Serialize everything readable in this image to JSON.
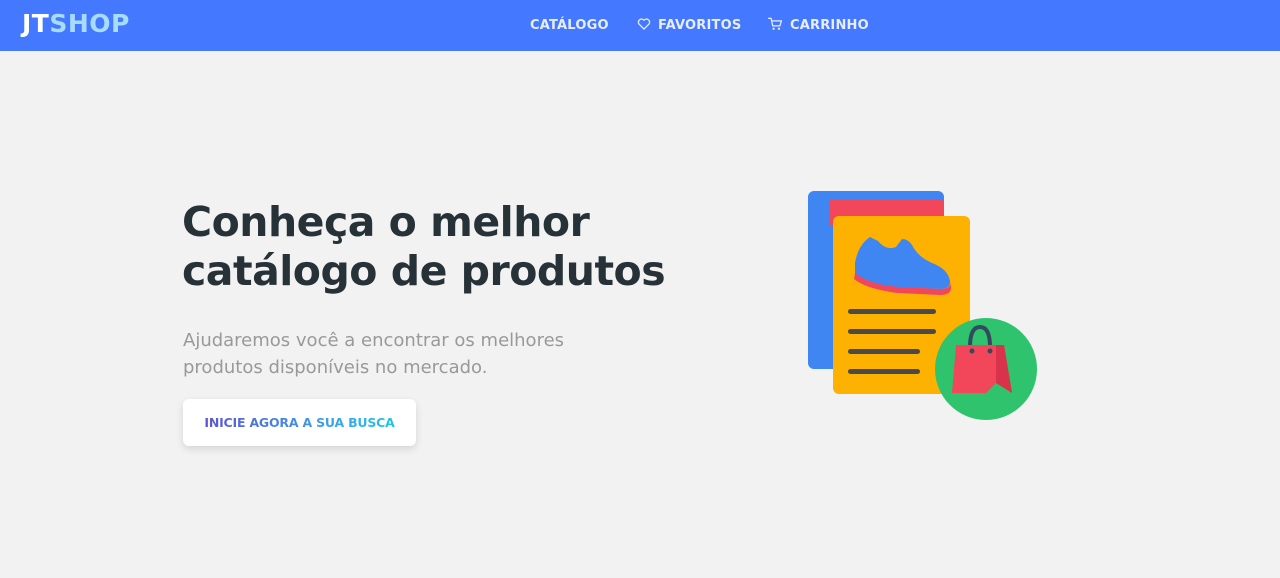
{
  "logo": {
    "part1": "JT",
    "part2": "SHOP"
  },
  "nav": {
    "items": [
      {
        "label": "CATÁLOGO",
        "icon": null
      },
      {
        "label": "FAVORITOS",
        "icon": "heart-icon"
      },
      {
        "label": "CARRINHO",
        "icon": "cart-icon"
      }
    ]
  },
  "hero": {
    "title_line1": "Conheça o melhor",
    "title_line2": "catálogo de produtos",
    "subtitle_line1": "Ajudaremos você a encontrar os melhores",
    "subtitle_line2": "produtos disponíveis no mercado.",
    "cta_label": "INICIE AGORA A SUA BUSCA"
  },
  "illustration": {
    "icon": "product-catalog-illustration"
  },
  "colors": {
    "header_bg": "#4479ff",
    "page_bg": "#f2f2f2",
    "title": "#263238",
    "subtitle": "#999999"
  }
}
